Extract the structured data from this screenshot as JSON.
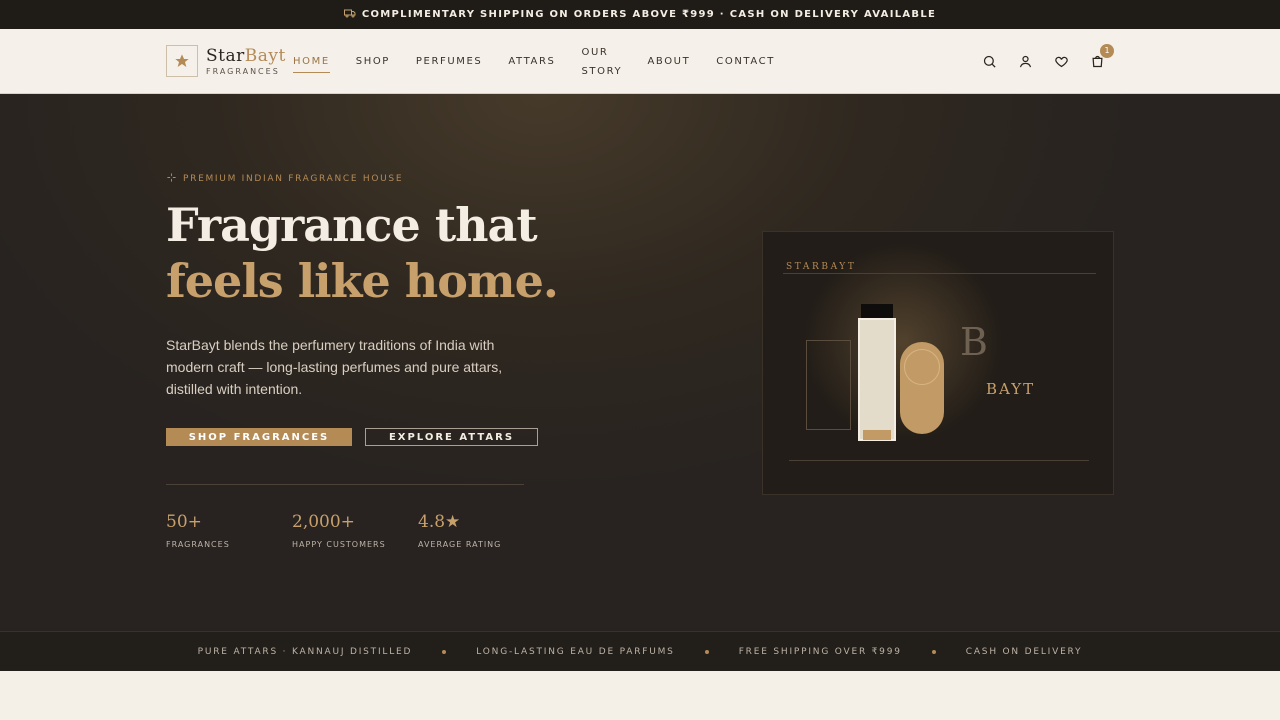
{
  "announcement": {
    "icon": "truck-icon",
    "text": "COMPLIMENTARY SHIPPING ON ORDERS ABOVE ₹999 · CASH ON DELIVERY AVAILABLE"
  },
  "brand": {
    "name_part1": "Star",
    "name_part2": "Bayt",
    "tagline": "FRAGRANCES",
    "logo_icon": "star-icon"
  },
  "nav": {
    "items": [
      {
        "label": "HOME",
        "active": true
      },
      {
        "label": "SHOP"
      },
      {
        "label": "PERFUMES"
      },
      {
        "label": "ATTARS"
      },
      {
        "label": "OUR STORY"
      },
      {
        "label": "ABOUT"
      },
      {
        "label": "CONTACT"
      }
    ]
  },
  "header_icons": {
    "search": "search-icon",
    "account": "user-icon",
    "wishlist": "heart-icon",
    "cart": "cart-icon",
    "cart_count": "1"
  },
  "hero": {
    "eyebrow": "PREMIUM INDIAN FRAGRANCE HOUSE",
    "eyebrow_icon": "sparkle-icon",
    "headline_line1": "Fragrance that",
    "headline_line2": "feels like home.",
    "description": "StarBayt blends the perfumery traditions of India with modern craft — long-lasting perfumes and pure attars, distilled with intention.",
    "primary_cta": "SHOP FRAGRANCES",
    "secondary_cta": "EXPLORE ATTARS",
    "stats": [
      {
        "value": "50+",
        "label": "FRAGRANCES"
      },
      {
        "value": "2,000+",
        "label": "HAPPY CUSTOMERS"
      },
      {
        "value": "4.8★",
        "label": "AVERAGE RATING"
      }
    ]
  },
  "product_card": {
    "brand_label": "STARBAYT",
    "letter": "B",
    "wordmark": "BAYT"
  },
  "strip": {
    "items": [
      "PURE ATTARS · KANNAUJ DISTILLED",
      "LONG-LASTING EAU DE PARFUMS",
      "FREE SHIPPING OVER ₹999",
      "CASH ON DELIVERY"
    ]
  },
  "colors": {
    "accent": "#b48a55",
    "dark": "#1f1b17",
    "cream": "#f5f1ea",
    "headline_gold": "#c7a06c"
  }
}
